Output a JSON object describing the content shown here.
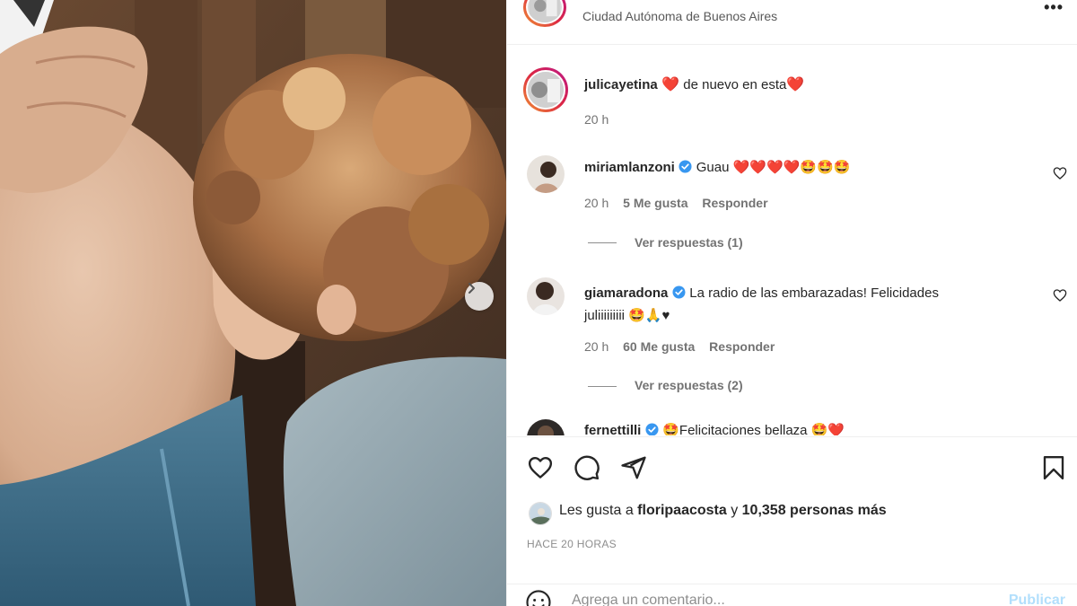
{
  "post": {
    "location": "Ciudad Autónoma de Buenos Aires",
    "more_label": "•••"
  },
  "caption": {
    "username": "julicayetina",
    "text": " de nuevo en esta",
    "time": "20 h"
  },
  "comments": [
    {
      "username": "miriamlanzoni",
      "verified": true,
      "text": "Guau ❤️❤️❤️❤️🤩🤩🤩",
      "time": "20 h",
      "likes": "5 Me gusta",
      "reply": "Responder",
      "view_replies": "Ver respuestas (1)"
    },
    {
      "username": "giamaradona",
      "verified": true,
      "text": "La radio de las embarazadas! Felicidades",
      "text2": "juliiiiiiiii 🤩🙏♥",
      "time": "20 h",
      "likes": "60 Me gusta",
      "reply": "Responder",
      "view_replies": "Ver respuestas (2)"
    },
    {
      "username": "fernettilli",
      "verified": true,
      "text": "🤩Felicitaciones bellaza 🤩❤️"
    }
  ],
  "likes": {
    "prefix": "Les gusta a ",
    "user": "floripaacosta",
    "middle": " y ",
    "count": "10,358 personas más"
  },
  "timestamp": "HACE 20 HORAS",
  "add_comment": {
    "placeholder": "Agrega un comentario...",
    "post_label": "Publicar"
  },
  "colors": {
    "verified": "#3897f0",
    "post_disabled": "#b2dffc",
    "heart": "#ed4956"
  }
}
